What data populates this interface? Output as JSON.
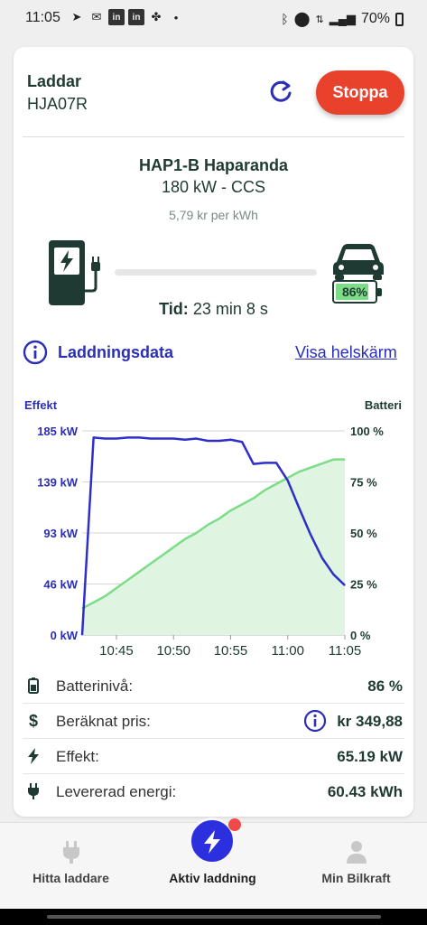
{
  "status_bar": {
    "time": "11:05",
    "battery": "70%",
    "left_icons": [
      "navigation-icon",
      "mail-icon",
      "linkedin-icon",
      "linkedin-icon",
      "fan-icon",
      "dot-icon"
    ],
    "right_icons": [
      "bluetooth-icon",
      "location-icon",
      "data-icon",
      "signal-icon",
      "battery-icon"
    ]
  },
  "header": {
    "title": "Laddar",
    "registration": "HJA07R",
    "stop_label": "Stoppa"
  },
  "station": {
    "name": "HAP1-B Haparanda",
    "power": "180 kW - CCS",
    "price": "5,79 kr per kWh",
    "battery_percent_label": "86%",
    "battery_level": 0.86,
    "time_label": "Tid:",
    "time_value": "23 min 8 s"
  },
  "data_section": {
    "title": "Laddningsdata",
    "fullscreen_link": "Visa helskärm"
  },
  "colors": {
    "accent": "#2b2fb5",
    "power_line": "#2e2fc9",
    "battery_line": "#7cdc88",
    "battery_fill": "#dff5e1",
    "stop": "#e8412c",
    "dark": "#1f3a33"
  },
  "chart_data": {
    "type": "line",
    "left_axis_title": "Effekt",
    "right_axis_title": "Batteri",
    "left_ticks": [
      "185 kW",
      "139 kW",
      "93 kW",
      "46 kW",
      "0 kW"
    ],
    "right_ticks": [
      "100 %",
      "75 %",
      "50 %",
      "25 %",
      "0 %"
    ],
    "x_ticks": [
      "10:45",
      "10:50",
      "10:55",
      "11:00",
      "11:05"
    ],
    "left_ylim": [
      0,
      185
    ],
    "right_ylim": [
      0,
      100
    ],
    "grid": true,
    "series": [
      {
        "axis": "left",
        "x": [
          "10:42",
          "10:43",
          "10:44",
          "10:45",
          "10:46",
          "10:47",
          "10:48",
          "10:49",
          "10:50",
          "10:51",
          "10:52",
          "10:53",
          "10:54",
          "10:55",
          "10:56",
          "10:57",
          "10:58",
          "10:59",
          "11:00",
          "11:01",
          "11:02",
          "11:03",
          "11:04",
          "11:05"
        ],
        "values": [
          0,
          179,
          178,
          178,
          179,
          179,
          178,
          178,
          178,
          177,
          178,
          176,
          176,
          177,
          175,
          155,
          156,
          156,
          140,
          115,
          91,
          70,
          55,
          45
        ]
      },
      {
        "axis": "right",
        "x": [
          "10:42",
          "10:43",
          "10:44",
          "10:45",
          "10:46",
          "10:47",
          "10:48",
          "10:49",
          "10:50",
          "10:51",
          "10:52",
          "10:53",
          "10:54",
          "10:55",
          "10:56",
          "10:57",
          "10:58",
          "10:59",
          "11:00",
          "11:01",
          "11:02",
          "11:03",
          "11:04",
          "11:05"
        ],
        "values": [
          13,
          16,
          19,
          23,
          27,
          31,
          35,
          39,
          43,
          47,
          50,
          54,
          57,
          61,
          64,
          67,
          71,
          74,
          77,
          80,
          82,
          84,
          86,
          86
        ]
      }
    ]
  },
  "details": [
    {
      "icon": "battery-icon",
      "label": "Batterinivå:",
      "value": "86 %",
      "info": false
    },
    {
      "icon": "dollar-icon",
      "label": "Beräknat pris:",
      "value": "kr 349,88",
      "info": true
    },
    {
      "icon": "lightning-icon",
      "label": "Effekt:",
      "value": "65.19 kW",
      "info": false
    },
    {
      "icon": "plug-icon",
      "label": "Levererad energi:",
      "value": "60.43 kWh",
      "info": false
    }
  ],
  "bottom_nav": {
    "items": [
      {
        "label": "Hitta laddare",
        "icon": "plug-icon"
      },
      {
        "label": "Aktiv laddning",
        "icon": "lightning-icon"
      },
      {
        "label": "Min Bilkraft",
        "icon": "person-icon"
      }
    ]
  }
}
